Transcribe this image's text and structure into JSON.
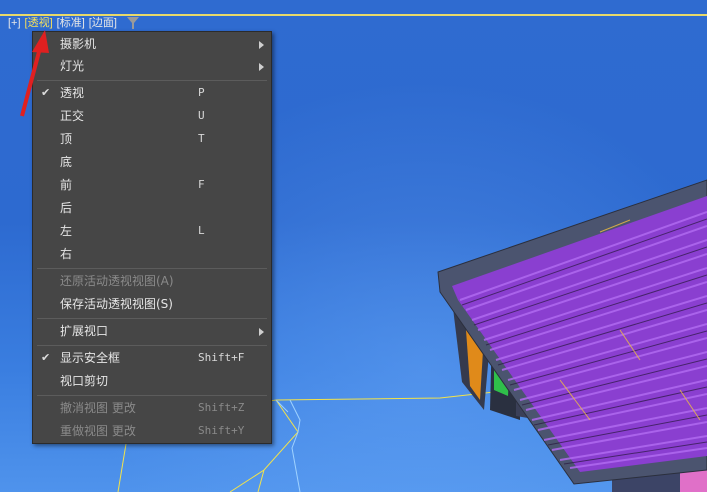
{
  "viewport_labels": {
    "plus": "[+]",
    "view": "透视",
    "shading": "[标准]",
    "edges": "[边面]"
  },
  "menu": {
    "items": [
      {
        "label": "摄影机",
        "submenu": true
      },
      {
        "label": "灯光",
        "submenu": true
      },
      {
        "label": "透视",
        "shortcut": "P",
        "checked": true
      },
      {
        "label": "正交",
        "shortcut": "U"
      },
      {
        "label": "顶",
        "shortcut": "T"
      },
      {
        "label": "底",
        "shortcut": ""
      },
      {
        "label": "前",
        "shortcut": "F"
      },
      {
        "label": "后",
        "shortcut": ""
      },
      {
        "label": "左",
        "shortcut": "L"
      },
      {
        "label": "右",
        "shortcut": ""
      },
      {
        "label": "还原活动透视视图(A)",
        "disabled": true
      },
      {
        "label": "保存活动透视视图(S)"
      },
      {
        "label": "扩展视口",
        "submenu": true
      },
      {
        "label": "显示安全框",
        "shortcut": "Shift+F",
        "checked": true
      },
      {
        "label": "视口剪切"
      },
      {
        "label": "撤消视图 更改",
        "shortcut": "Shift+Z",
        "disabled": true
      },
      {
        "label": "重做视图 更改",
        "shortcut": "Shift+Y",
        "disabled": true
      }
    ],
    "check_glyph": "✔"
  },
  "colors": {
    "viewport_bg": "#2f6fd0",
    "menu_bg": "#464646",
    "active_label": "#f5e05a",
    "annotation_arrow": "#e02020",
    "roof": "#8a3fd0"
  },
  "icons": {
    "filter": "filter-icon",
    "submenu": "chevron-right-icon",
    "check": "check-icon"
  }
}
